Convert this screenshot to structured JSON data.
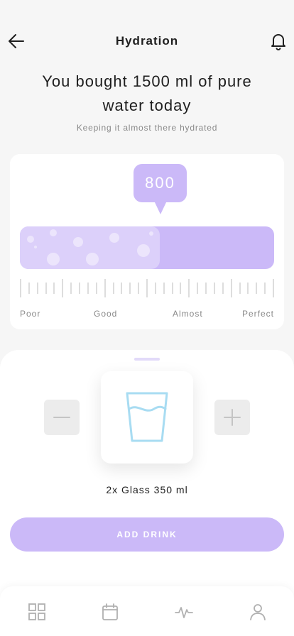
{
  "header": {
    "title": "Hydration",
    "back_icon": "arrow-left-icon",
    "notifications_icon": "bell-icon"
  },
  "summary": {
    "headline": "You bought 1500 ml of pure water today",
    "subline": "Keeping it almost there hydrated"
  },
  "meter": {
    "current_value": "800",
    "fill_fraction": 0.55,
    "scale_labels": [
      "Poor",
      "Good",
      "Almost",
      "Perfect"
    ]
  },
  "selector": {
    "decrease_icon": "minus-icon",
    "increase_icon": "plus-icon",
    "drink_icon": "water-glass-icon",
    "selection_label": "2x Glass 350 ml"
  },
  "actions": {
    "add_drink_label": "ADD DRINK"
  },
  "tab_bar": {
    "items": [
      {
        "icon": "dashboard-grid-icon"
      },
      {
        "icon": "calendar-icon"
      },
      {
        "icon": "activity-pulse-icon"
      },
      {
        "icon": "profile-icon"
      }
    ]
  },
  "colors": {
    "accent": "#cbb9f8",
    "accent_light": "#dcd0fa",
    "background": "#f6f6f6",
    "glass_blue": "#a8dcf2"
  }
}
